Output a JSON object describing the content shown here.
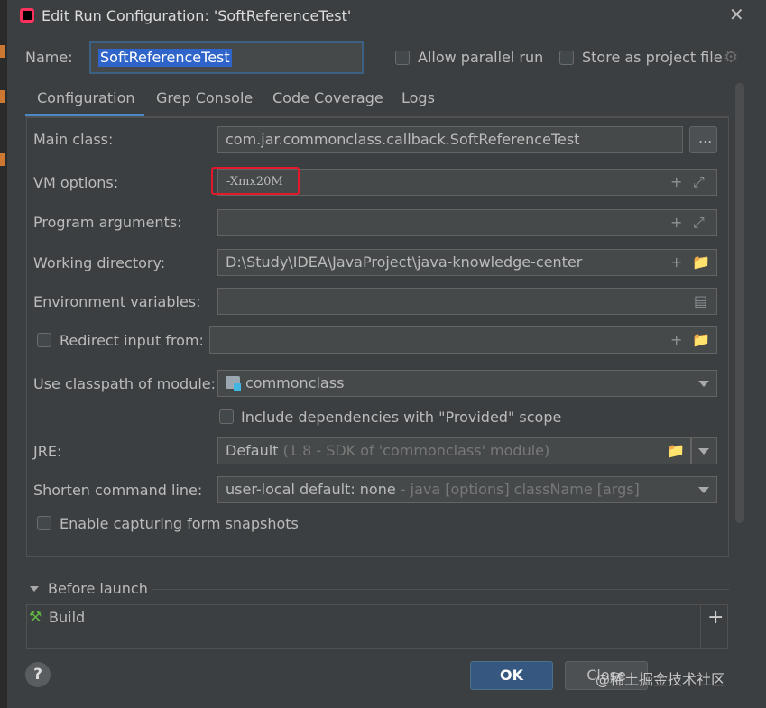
{
  "window": {
    "title": "Edit Run Configuration: 'SoftReferenceTest'",
    "close_icon": "close-icon"
  },
  "name_row": {
    "label": "Name:",
    "value": "SoftReferenceTest",
    "allow_parallel": "Allow parallel run",
    "store_as_file": "Store as project file"
  },
  "tabs": [
    {
      "label": "Configuration",
      "active": true
    },
    {
      "label": "Grep Console"
    },
    {
      "label": "Code Coverage"
    },
    {
      "label": "Logs"
    }
  ],
  "config": {
    "main_class": {
      "label": "Main class:",
      "value": "com.jar.commonclass.callback.SoftReferenceTest",
      "browse": "..."
    },
    "vm_options": {
      "label": "VM options:",
      "value": "-Xmx20M"
    },
    "program_args": {
      "label": "Program arguments:",
      "value": ""
    },
    "working_dir": {
      "label": "Working directory:",
      "value": "D:\\Study\\IDEA\\JavaProject\\java-knowledge-center"
    },
    "env_vars": {
      "label": "Environment variables:",
      "value": ""
    },
    "redirect_input": {
      "label": "Redirect input from:",
      "value": ""
    },
    "classpath": {
      "label": "Use classpath of module:",
      "value": "commonclass"
    },
    "include_deps": {
      "label": "Include dependencies with \"Provided\" scope"
    },
    "jre": {
      "label": "JRE:",
      "value": "Default",
      "hint": "(1.8 - SDK of 'commonclass' module)"
    },
    "shorten": {
      "label": "Shorten command line:",
      "value": "user-local default: none",
      "hint": "- java [options] className [args]"
    },
    "capture_snapshots": {
      "label": "Enable capturing form snapshots"
    }
  },
  "before_launch": {
    "label": "Before launch",
    "items": [
      "Build"
    ]
  },
  "footer": {
    "help": "?",
    "ok": "OK",
    "close": "Close",
    "watermark": "@稀土掘金技术社区"
  },
  "colors": {
    "accent": "#4a88c7",
    "highlight_box": "#e2192a",
    "ok_button": "#365880"
  }
}
